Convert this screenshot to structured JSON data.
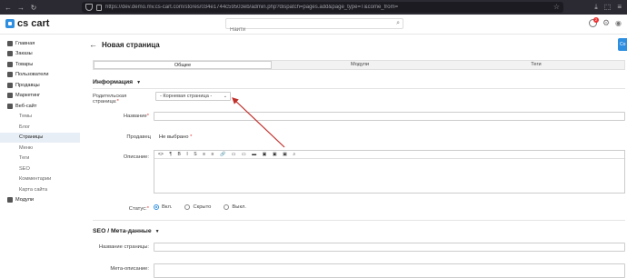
{
  "browser": {
    "url": "https://dev.demo.mv.cs-cart.com/stores/034e1744c59503eb/admin.php?dispatch=pages.add&page_type=T&come_from="
  },
  "topbar": {
    "logo_text": "cs cart",
    "search_placeholder": "Найти",
    "notification_count": "2"
  },
  "sidebar": {
    "items": [
      {
        "label": "Главная",
        "type": "main"
      },
      {
        "label": "Заказы",
        "type": "main"
      },
      {
        "label": "Товары",
        "type": "main"
      },
      {
        "label": "Пользователи",
        "type": "main"
      },
      {
        "label": "Продавцы",
        "type": "main"
      },
      {
        "label": "Маркетинг",
        "type": "main"
      },
      {
        "label": "Веб-сайт",
        "type": "main"
      },
      {
        "label": "Темы",
        "type": "sub"
      },
      {
        "label": "Блог",
        "type": "sub"
      },
      {
        "label": "Страницы",
        "type": "sub",
        "active": true
      },
      {
        "label": "Меню",
        "type": "sub"
      },
      {
        "label": "Теги",
        "type": "sub"
      },
      {
        "label": "SEO",
        "type": "sub"
      },
      {
        "label": "Комментарии",
        "type": "sub"
      },
      {
        "label": "Карта сайта",
        "type": "sub"
      },
      {
        "label": "Модули",
        "type": "main"
      }
    ]
  },
  "page": {
    "title": "Новая страница",
    "save_label": "Со"
  },
  "tabs": [
    "Общее",
    "Модули",
    "Теги"
  ],
  "info_section": {
    "title": "Информация",
    "parent_label": "Родительская страница:",
    "parent_value": "- Корневая страница -",
    "name_label": "Название",
    "vendor_label": "Продавец",
    "vendor_value": "Не выбрано",
    "description_label": "Описание:",
    "status_label": "Статус:",
    "status_options": [
      "Вкл.",
      "Скрыто",
      "Выкл."
    ],
    "status_selected": "Вкл."
  },
  "seo_section": {
    "title": "SEO / Мета-данные",
    "page_title_label": "Название страницы:",
    "meta_desc_label": "Мета-описание:"
  },
  "editor_toolbar": [
    "<>",
    "¶",
    "B",
    "I",
    "S",
    "≡",
    "≡",
    "🔗",
    "▭",
    "▭",
    "▬",
    "▣",
    "▣",
    "▣",
    "⌕"
  ],
  "colors": {
    "accent": "#2e8fe0",
    "annotation_arrow": "#c0302b"
  }
}
